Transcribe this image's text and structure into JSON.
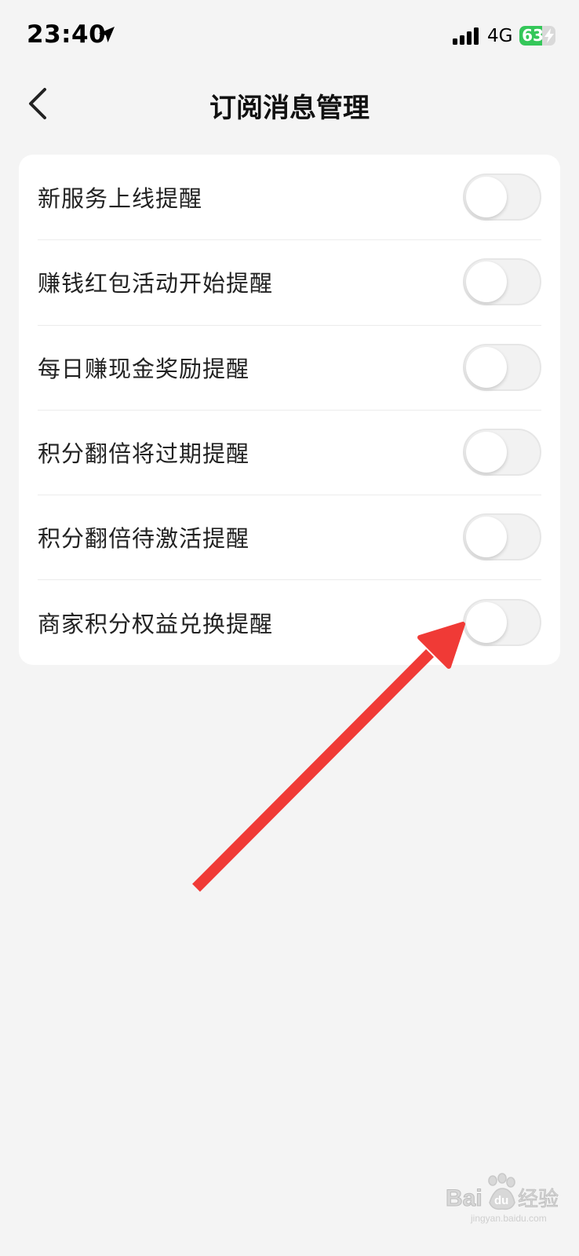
{
  "status_bar": {
    "time": "23:40",
    "network": "4G",
    "battery": "63",
    "battery_level": 0.63,
    "icons": [
      "location-arrow-icon",
      "signal-bars-icon",
      "battery-charging-icon"
    ]
  },
  "nav": {
    "title": "订阅消息管理",
    "back_icon": "chevron-left-icon"
  },
  "settings": {
    "items": [
      {
        "label": "新服务上线提醒",
        "enabled": false
      },
      {
        "label": "赚钱红包活动开始提醒",
        "enabled": false
      },
      {
        "label": "每日赚现金奖励提醒",
        "enabled": false
      },
      {
        "label": "积分翻倍将过期提醒",
        "enabled": false
      },
      {
        "label": "积分翻倍待激活提醒",
        "enabled": false
      },
      {
        "label": "商家积分权益兑换提醒",
        "enabled": false
      }
    ]
  },
  "annotation": {
    "arrow_color": "#f03a36",
    "points_to": "商家积分权益兑换提醒"
  },
  "watermark": {
    "text": "Baidu经验",
    "url_text": "jingyan.baidu.com"
  },
  "colors": {
    "background": "#f4f4f4",
    "card": "#ffffff",
    "battery_green": "#34c759"
  }
}
